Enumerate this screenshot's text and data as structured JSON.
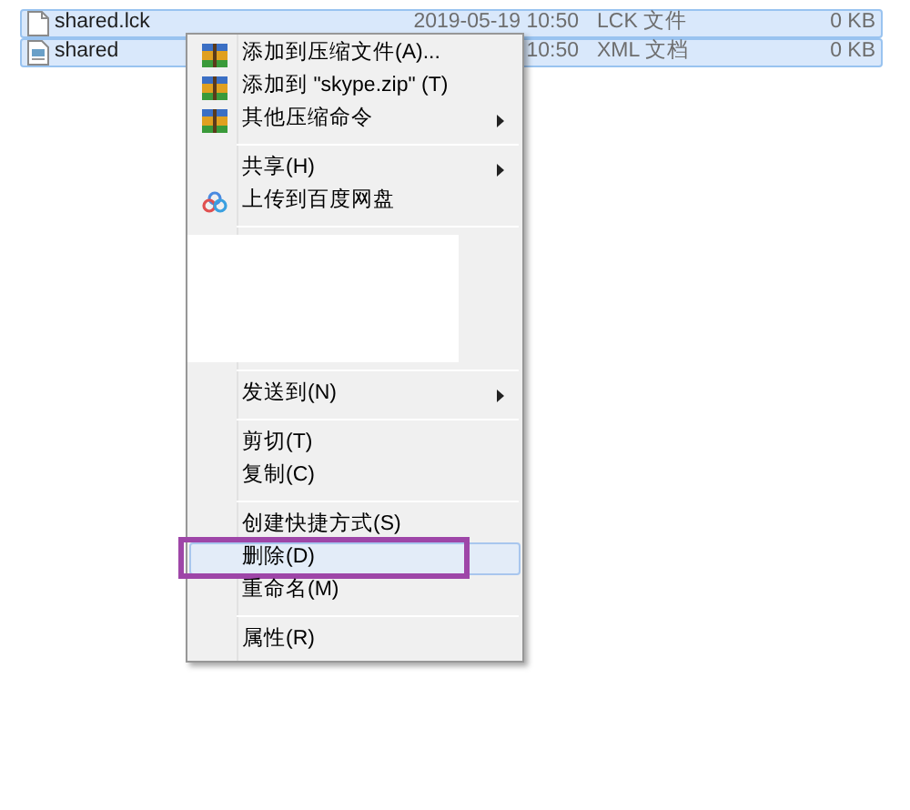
{
  "files": [
    {
      "name": "shared.lck",
      "date": "2019-05-19 10:50",
      "type": "LCK 文件",
      "size": "0 KB",
      "kind": "blank",
      "selected": true
    },
    {
      "name": "shared",
      "date": "10:50",
      "type": "XML 文档",
      "size": "0 KB",
      "kind": "xml",
      "selected": true
    }
  ],
  "context_menu": {
    "items": [
      {
        "kind": "archive",
        "label": "添加到压缩文件(A)...",
        "submenu": false,
        "selected": false
      },
      {
        "kind": "archive",
        "label": "添加到 \"skype.zip\" (T)",
        "submenu": false,
        "selected": false
      },
      {
        "kind": "archive",
        "label": "其他压缩命令",
        "submenu": true,
        "selected": false
      },
      {
        "kind": "separator"
      },
      {
        "kind": "plain",
        "label": "共享(H)",
        "submenu": true,
        "selected": false
      },
      {
        "kind": "cloud",
        "label": "上传到百度网盘",
        "submenu": false,
        "selected": false
      },
      {
        "kind": "separator"
      },
      {
        "kind": "blank"
      },
      {
        "kind": "separator"
      },
      {
        "kind": "plain",
        "label": "发送到(N)",
        "submenu": true,
        "selected": false
      },
      {
        "kind": "separator"
      },
      {
        "kind": "plain",
        "label": "剪切(T)",
        "submenu": false,
        "selected": false
      },
      {
        "kind": "plain",
        "label": "复制(C)",
        "submenu": false,
        "selected": false
      },
      {
        "kind": "separator"
      },
      {
        "kind": "plain",
        "label": "创建快捷方式(S)",
        "submenu": false,
        "selected": false
      },
      {
        "kind": "plain",
        "label": "删除(D)",
        "submenu": false,
        "selected": true,
        "annotated": true
      },
      {
        "kind": "plain",
        "label": "重命名(M)",
        "submenu": false,
        "selected": false
      },
      {
        "kind": "separator"
      },
      {
        "kind": "plain",
        "label": "属性(R)",
        "submenu": false,
        "selected": false
      }
    ]
  }
}
